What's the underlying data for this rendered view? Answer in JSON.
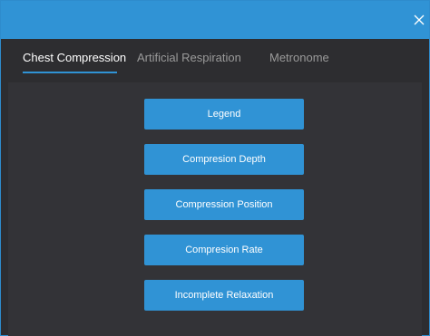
{
  "window": {
    "close_icon": "close-icon"
  },
  "tabs": [
    {
      "label": "Chest Compression",
      "active": true
    },
    {
      "label": "Artificial Respiration",
      "active": false
    },
    {
      "label": "Metronome",
      "active": false
    }
  ],
  "buttons": [
    {
      "label": "Legend"
    },
    {
      "label": "Compresion Depth"
    },
    {
      "label": "Compression Position"
    },
    {
      "label": "Compresion Rate"
    },
    {
      "label": "Incomplete Relaxation"
    }
  ],
  "colors": {
    "accent": "#3093d5",
    "background": "#2d2d30",
    "panel": "#333337",
    "inactive_tab_text": "#9a9a9a",
    "active_tab_text": "#ffffff"
  }
}
